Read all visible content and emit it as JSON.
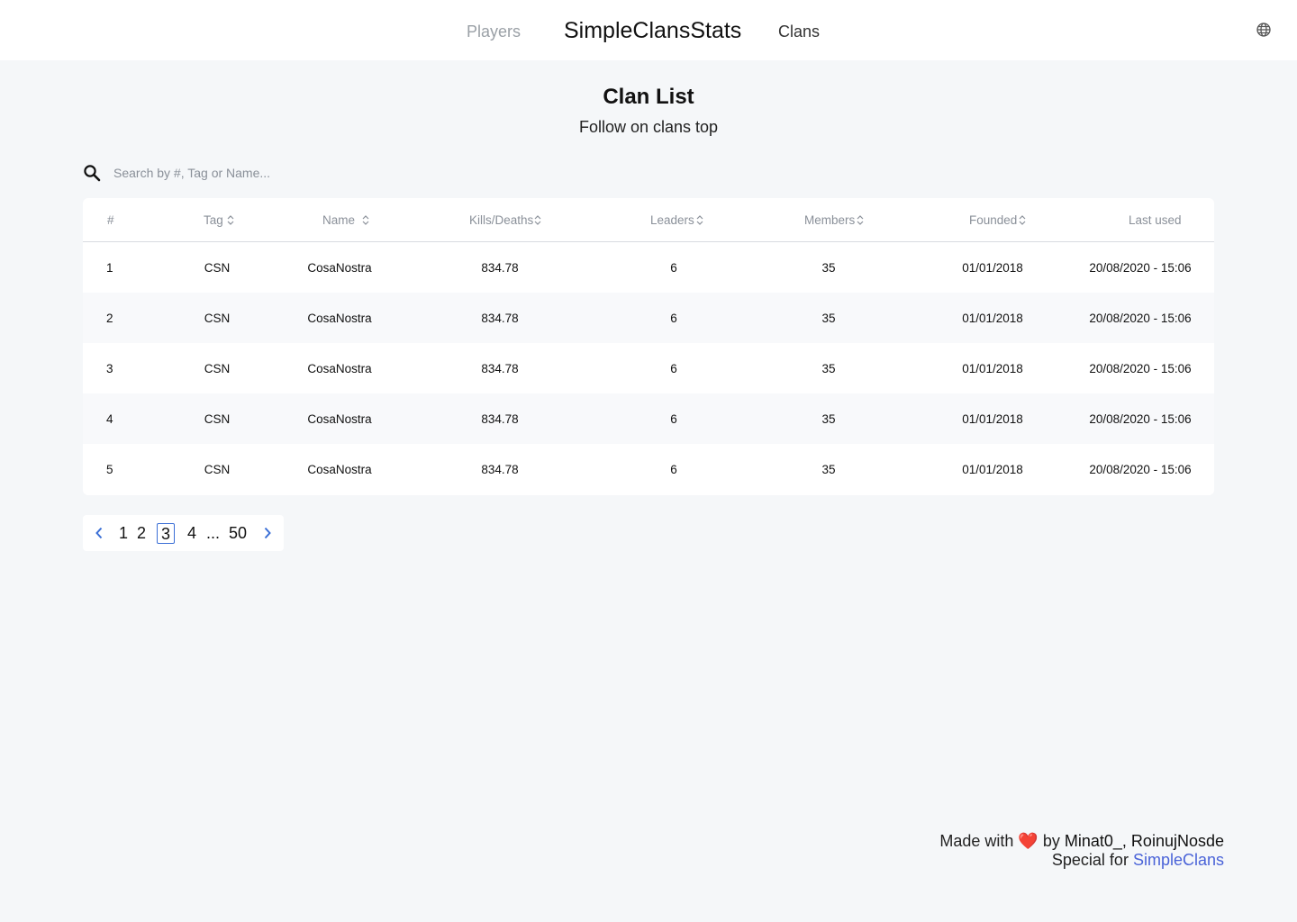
{
  "header": {
    "nav_players": "Players",
    "brand": "SimpleClansStats",
    "nav_clans": "Clans",
    "theme_icon": "moon-icon",
    "language_icon": "globe-icon"
  },
  "page": {
    "title": "Clan List",
    "subtitle": "Follow on clans top"
  },
  "search": {
    "placeholder": "Search by #, Tag or Name...",
    "value": ""
  },
  "table": {
    "columns": {
      "rank": "#",
      "tag": "Tag",
      "name": "Name",
      "kd": "Kills/Deaths",
      "leaders": "Leaders",
      "members": "Members",
      "founded": "Founded",
      "last_used": "Last used"
    },
    "rows": [
      {
        "rank": "1",
        "tag": "CSN",
        "name": "CosaNostra",
        "kd": "834.78",
        "leaders": "6",
        "members": "35",
        "founded": "01/01/2018",
        "last_used": "20/08/2020 - 15:06"
      },
      {
        "rank": "2",
        "tag": "CSN",
        "name": "CosaNostra",
        "kd": "834.78",
        "leaders": "6",
        "members": "35",
        "founded": "01/01/2018",
        "last_used": "20/08/2020 - 15:06"
      },
      {
        "rank": "3",
        "tag": "CSN",
        "name": "CosaNostra",
        "kd": "834.78",
        "leaders": "6",
        "members": "35",
        "founded": "01/01/2018",
        "last_used": "20/08/2020 - 15:06"
      },
      {
        "rank": "4",
        "tag": "CSN",
        "name": "CosaNostra",
        "kd": "834.78",
        "leaders": "6",
        "members": "35",
        "founded": "01/01/2018",
        "last_used": "20/08/2020 - 15:06"
      },
      {
        "rank": "5",
        "tag": "CSN",
        "name": "CosaNostra",
        "kd": "834.78",
        "leaders": "6",
        "members": "35",
        "founded": "01/01/2018",
        "last_used": "20/08/2020 - 15:06"
      }
    ]
  },
  "pagination": {
    "pages": [
      "1",
      "2",
      "3",
      "4"
    ],
    "ellipsis": "...",
    "last": "50",
    "current": "3"
  },
  "footer": {
    "made_with": "Made with",
    "by": "by",
    "authors": "Minat0_, RoinujNosde",
    "special_for": "Special for",
    "link": "SimpleClans"
  },
  "colors": {
    "accent": "#3b6fd6",
    "link": "#4a63d8",
    "heart": "#e0262b",
    "background": "#f5f7f9"
  }
}
